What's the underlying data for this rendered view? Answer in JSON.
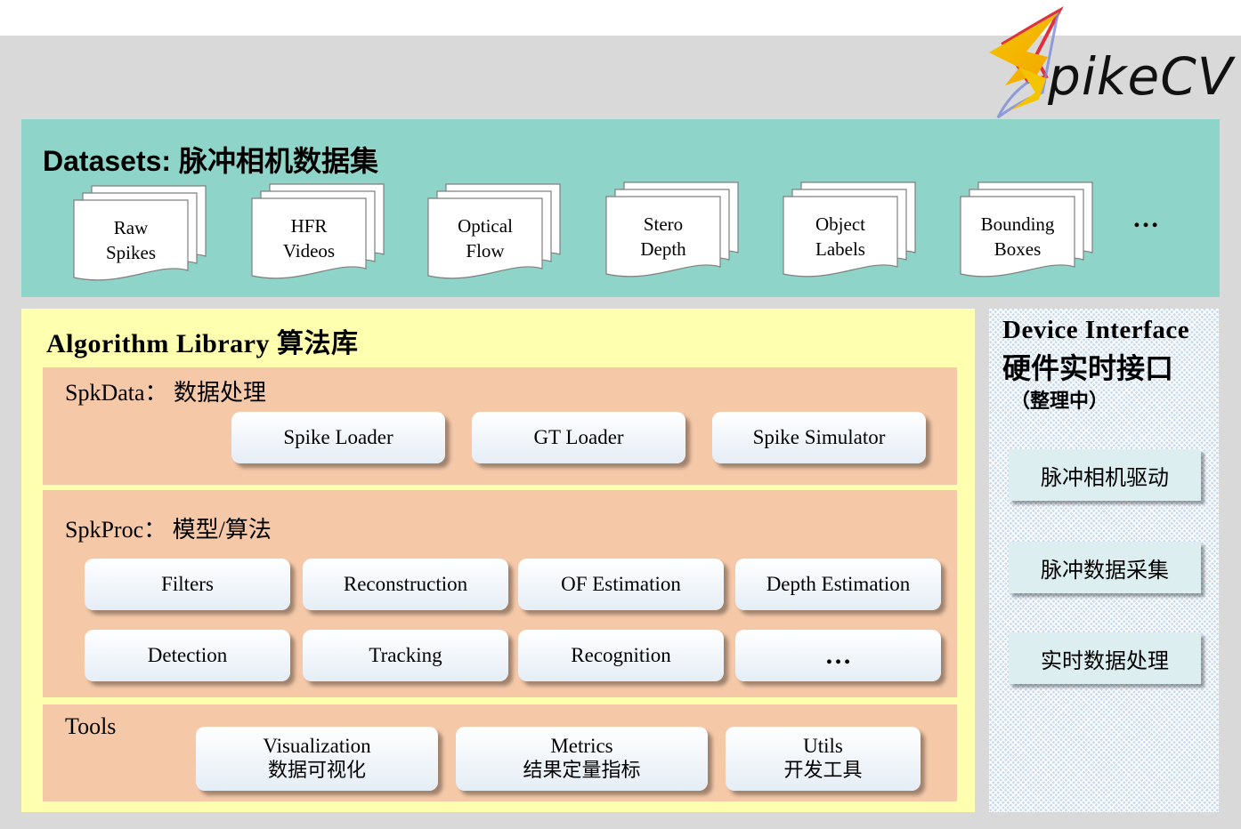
{
  "logo": {
    "text": "pikeCV",
    "icon": "lightning-s-icon",
    "colors": [
      "#f5c400",
      "#e0303c",
      "#7a8ad8"
    ]
  },
  "datasets": {
    "title": "Datasets: 脉冲相机数据集",
    "items": [
      {
        "line1": "Raw",
        "line2": "Spikes"
      },
      {
        "line1": "HFR",
        "line2": "Videos"
      },
      {
        "line1": "Optical",
        "line2": "Flow"
      },
      {
        "line1": "Stero",
        "line2": "Depth"
      },
      {
        "line1": "Object",
        "line2": "Labels"
      },
      {
        "line1": "Bounding",
        "line2": "Boxes"
      }
    ],
    "more": "…"
  },
  "algorithm": {
    "title": "Algorithm Library 算法库",
    "spkdata": {
      "title": "SpkData：  数据处理",
      "buttons": [
        "Spike Loader",
        "GT Loader",
        "Spike Simulator"
      ]
    },
    "spkproc": {
      "title": "SpkProc：  模型/算法",
      "buttons": [
        "Filters",
        "Reconstruction",
        "OF Estimation",
        "Depth Estimation",
        "Detection",
        "Tracking",
        "Recognition",
        "…"
      ]
    },
    "tools": {
      "title": "Tools",
      "buttons": [
        {
          "en": "Visualization",
          "zh": "数据可视化"
        },
        {
          "en": "Metrics",
          "zh": "结果定量指标"
        },
        {
          "en": "Utils",
          "zh": "开发工具"
        }
      ]
    }
  },
  "device": {
    "title": "Device Interface",
    "subtitle": "硬件实时接口",
    "note": "（整理中）",
    "buttons": [
      "脉冲相机驱动",
      "脉冲数据采集",
      "实时数据处理"
    ]
  },
  "colors": {
    "background": "#d9d9d9",
    "datasets_bg": "#8fd4c8",
    "algorithm_bg": "#ffffb0",
    "panel_bg": "#f5c8a8",
    "device_bg": "#c8dbee"
  }
}
